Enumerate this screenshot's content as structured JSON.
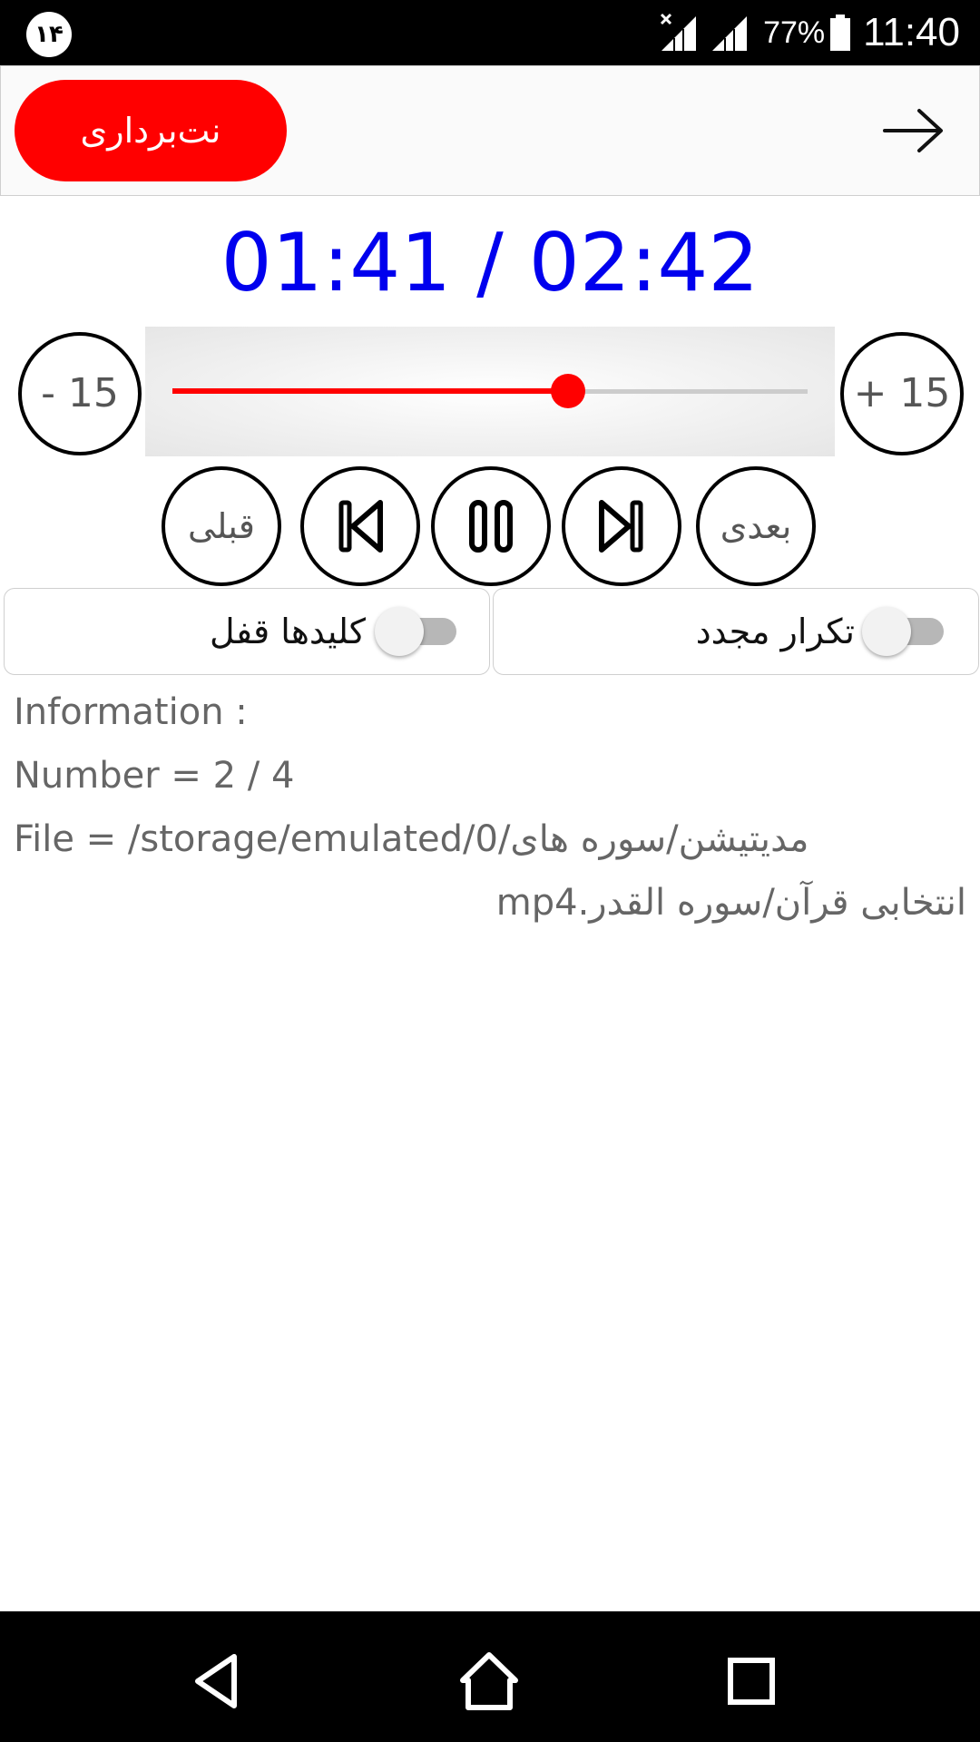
{
  "status_bar": {
    "notification_badge": "۱۴",
    "battery_percent": "77%",
    "time": "11:40",
    "icons": [
      "signal-no-data-icon",
      "signal-icon",
      "battery-icon"
    ]
  },
  "app_bar": {
    "notes_button_label": "نت‌برداری",
    "back_icon": "arrow-right-icon",
    "accent_color": "#ff0000"
  },
  "player": {
    "time_display": "01:41 / 02:42",
    "time_color": "#0000ee",
    "seek_back_label": "- 15",
    "seek_forward_label": "+ 15",
    "progress": 0.623,
    "progress_color": "#ff0000"
  },
  "controls": {
    "previous_label": "قبلی",
    "next_label": "بعدی",
    "icons": [
      "skip-back-icon",
      "pause-icon",
      "skip-forward-icon"
    ]
  },
  "toggles": {
    "lock_keys_label": "کلیدها قفل",
    "lock_keys_on": false,
    "repeat_label": "تکرار مجدد",
    "repeat_on": false
  },
  "info": {
    "heading": "Information :",
    "number": "Number = 2 / 4",
    "file_line_1": "File = /storage/emulated/0/مدیتیشن/سوره های",
    "file_line_2": "انتخابی قرآن/سوره القدر.mp4"
  },
  "nav_bar": {
    "icons": [
      "back-triangle-icon",
      "home-icon",
      "recents-icon"
    ]
  }
}
